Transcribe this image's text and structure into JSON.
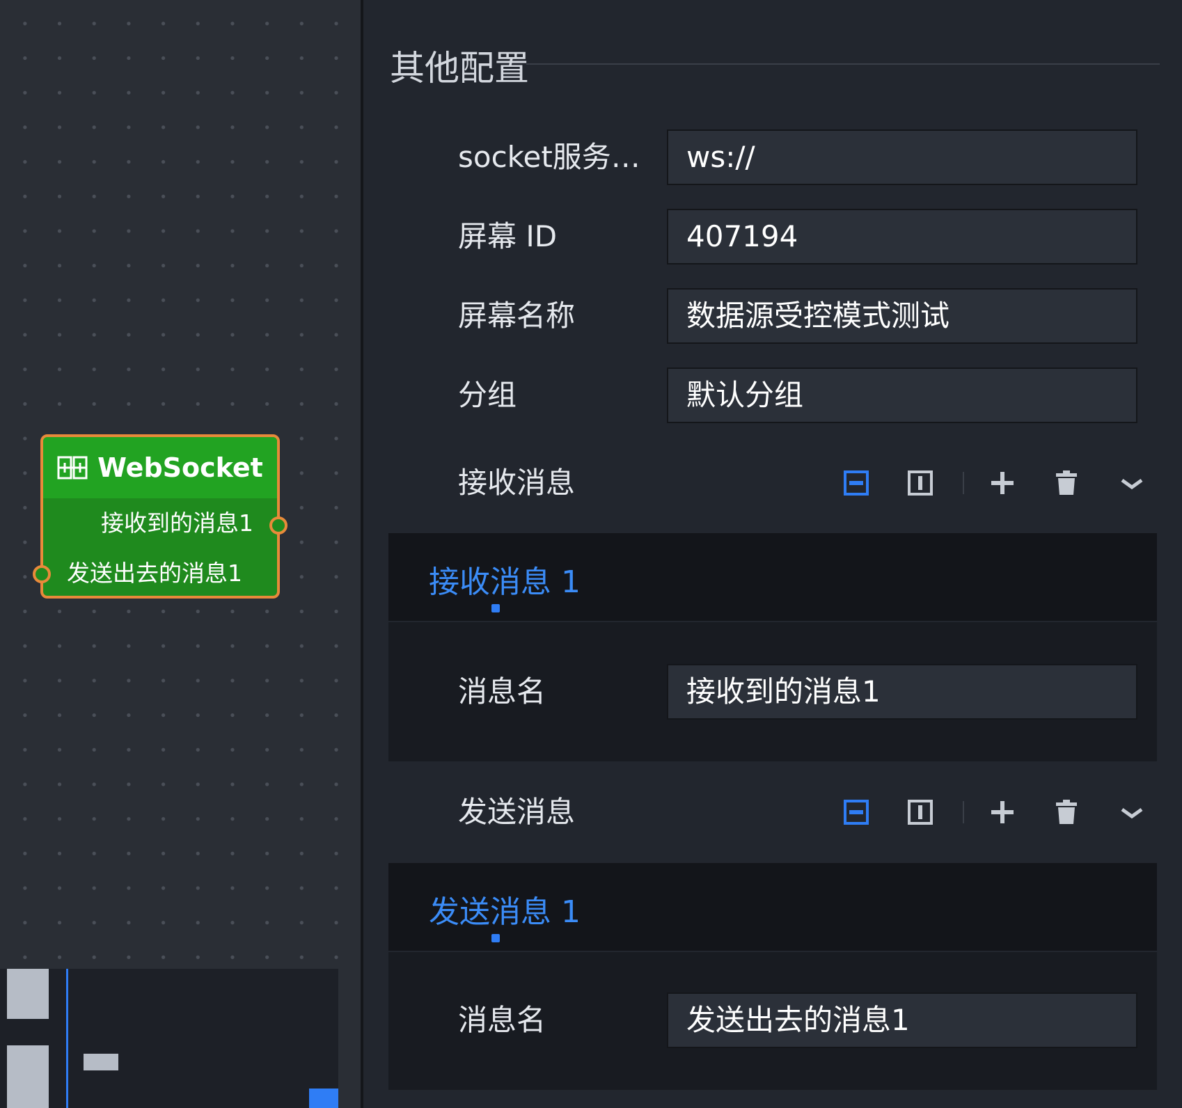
{
  "canvas": {
    "node": {
      "title": "WebSocket",
      "output_port": "接收到的消息1",
      "input_port": "发送出去的消息1"
    }
  },
  "panel": {
    "section_title": "其他配置",
    "fields": {
      "socket_url": {
        "label": "socket服务…",
        "value": "ws://"
      },
      "screen_id": {
        "label": "屏幕 ID",
        "value": "407194"
      },
      "screen_name": {
        "label": "屏幕名称",
        "value": "数据源受控模式测试"
      },
      "group": {
        "label": "分组",
        "value": "默认分组"
      }
    },
    "receive": {
      "label": "接收消息",
      "tab": "接收消息 1",
      "name_label": "消息名",
      "name_value": "接收到的消息1"
    },
    "send": {
      "label": "发送消息",
      "tab": "发送消息 1",
      "name_label": "消息名",
      "name_value": "发送出去的消息1"
    },
    "toolbar_icons": [
      "collapse-rows-icon",
      "collapse-columns-icon",
      "plus-icon",
      "trash-icon",
      "chevron-down-icon"
    ]
  },
  "colors": {
    "accent": "#2f7df5",
    "node_green": "#22a322",
    "node_border": "#e88a3a",
    "panel_bg": "#22262e"
  }
}
